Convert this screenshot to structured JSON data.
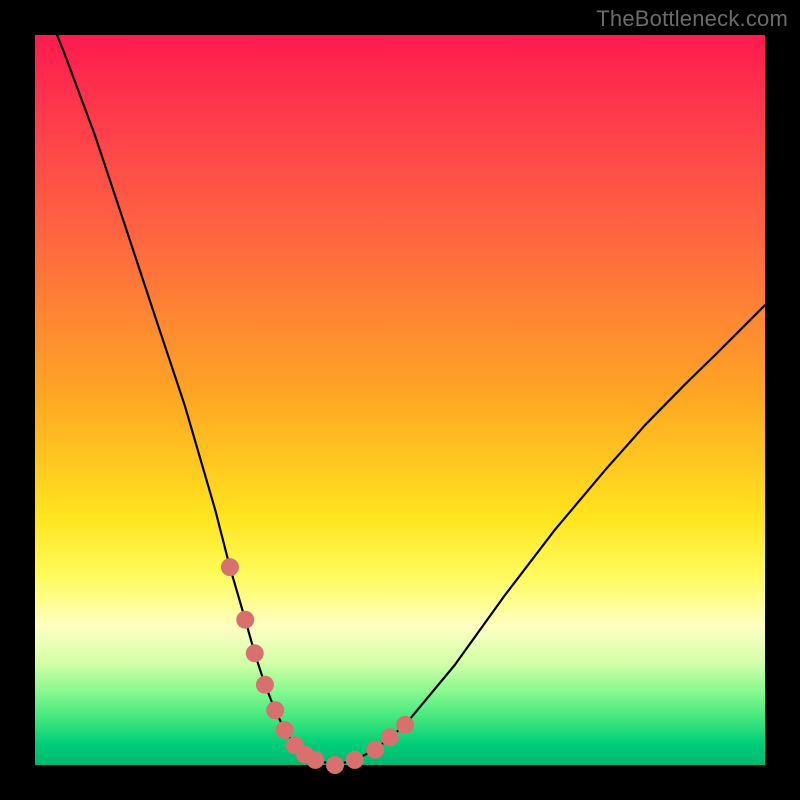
{
  "watermark": "TheBottleneck.com",
  "chart_data": {
    "type": "line",
    "title": "",
    "xlabel": "",
    "ylabel": "",
    "xlim": [
      0,
      100
    ],
    "ylim": [
      0,
      100
    ],
    "series": [
      {
        "name": "bottleneck-curve",
        "x": [
          0,
          4.1,
          8.2,
          12.3,
          16.4,
          20.5,
          24.7,
          26.7,
          28.8,
          30.1,
          31.5,
          32.9,
          34.2,
          35.6,
          37.0,
          38.4,
          41.1,
          43.8,
          46.6,
          50.7,
          57.5,
          64.4,
          71.2,
          78.1,
          83.6,
          89.0,
          93.2,
          97.3,
          100.0
        ],
        "values": [
          107.5,
          97.3,
          86.3,
          74.0,
          61.6,
          49.3,
          34.9,
          27.1,
          19.9,
          15.3,
          11.0,
          7.5,
          4.8,
          2.7,
          1.4,
          0.7,
          0.0,
          0.7,
          2.1,
          5.5,
          13.7,
          23.3,
          32.2,
          40.4,
          46.6,
          52.1,
          56.2,
          60.3,
          63.0
        ]
      }
    ],
    "markers": [
      {
        "x": 26.7,
        "y": 27.1
      },
      {
        "x": 28.8,
        "y": 19.9
      },
      {
        "x": 30.1,
        "y": 15.3
      },
      {
        "x": 31.5,
        "y": 11.0
      },
      {
        "x": 32.9,
        "y": 7.5
      },
      {
        "x": 34.2,
        "y": 4.8
      },
      {
        "x": 35.6,
        "y": 2.7
      },
      {
        "x": 37.0,
        "y": 1.4
      },
      {
        "x": 38.4,
        "y": 0.7
      },
      {
        "x": 41.1,
        "y": 0.0
      },
      {
        "x": 43.8,
        "y": 0.7
      },
      {
        "x": 46.6,
        "y": 2.1
      },
      {
        "x": 48.6,
        "y": 3.8
      },
      {
        "x": 50.7,
        "y": 5.5
      }
    ],
    "gradient_stops": [
      {
        "pos": 0.0,
        "color": "#ff1a4e"
      },
      {
        "pos": 0.12,
        "color": "#ff3d4b"
      },
      {
        "pos": 0.28,
        "color": "#ff6740"
      },
      {
        "pos": 0.5,
        "color": "#ffa823"
      },
      {
        "pos": 0.66,
        "color": "#ffe41e"
      },
      {
        "pos": 0.74,
        "color": "#fffb5c"
      },
      {
        "pos": 0.81,
        "color": "#ffffc2"
      },
      {
        "pos": 0.86,
        "color": "#d2ffa8"
      },
      {
        "pos": 0.9,
        "color": "#85f98f"
      },
      {
        "pos": 0.94,
        "color": "#3ae57c"
      },
      {
        "pos": 0.97,
        "color": "#00cf78"
      },
      {
        "pos": 1.0,
        "color": "#00b870"
      }
    ],
    "marker_color": "#d8706f",
    "curve_color": "#000000"
  }
}
